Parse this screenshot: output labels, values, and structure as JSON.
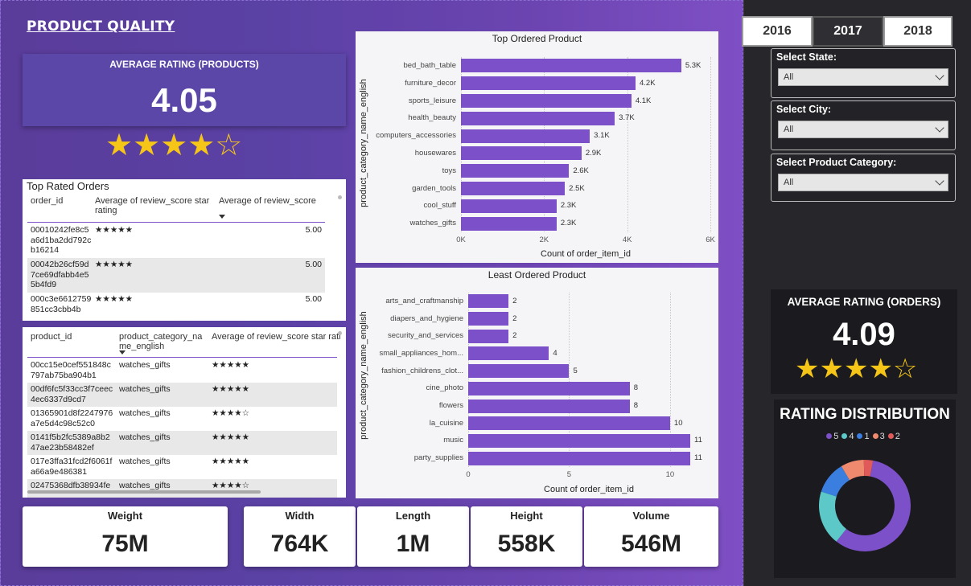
{
  "header": {
    "title": "PRODUCT QUALITY"
  },
  "avg_rating_products": {
    "label": "AVERAGE RATING (PRODUCTS)",
    "value": "4.05",
    "stars": "★★★★☆"
  },
  "top_rated_orders": {
    "title": "Top Rated Orders",
    "headers": [
      "order_id",
      "Average of review_score star rating",
      "Average of review_score"
    ],
    "rows": [
      {
        "order_id": "00010242fe8c5a6d1ba2dd792cb16214",
        "stars": "★★★★★",
        "score": "5.00"
      },
      {
        "order_id": "00042b26cf59d7ce69dfabb4e55b4fd9",
        "stars": "★★★★★",
        "score": "5.00"
      },
      {
        "order_id": "000c3e6612759851cc3cbb4b",
        "stars": "★★★★★",
        "score": "5.00"
      }
    ]
  },
  "product_table": {
    "headers": [
      "product_id",
      "product_category_name_english",
      "Average of review_score star ratir"
    ],
    "rows": [
      {
        "product_id": "00cc15e0cef551848c797ab75ba904b1",
        "category": "watches_gifts",
        "stars": "★★★★★"
      },
      {
        "product_id": "00df6fc5f33cc3f7ceec4ec6337d9cd7",
        "category": "watches_gifts",
        "stars": "★★★★★"
      },
      {
        "product_id": "01365901d8f2247976a7e5d4c98c52c0",
        "category": "watches_gifts",
        "stars": "★★★★☆"
      },
      {
        "product_id": "0141f5b2fc5389a8b247ae23b58482ef",
        "category": "watches_gifts",
        "stars": "★★★★★"
      },
      {
        "product_id": "017e3ffa31fcd2f6061fa66a9e486381",
        "category": "watches_gifts",
        "stars": "★★★★★"
      },
      {
        "product_id": "02475368dfb38934fe",
        "category": "watches_gifts",
        "stars": "★★★★☆"
      }
    ]
  },
  "chart_data": [
    {
      "type": "bar",
      "orientation": "horizontal",
      "title": "Top Ordered Product",
      "xlabel": "Count of order_item_id",
      "ylabel": "product_category_name_english",
      "categories": [
        "bed_bath_table",
        "furniture_decor",
        "sports_leisure",
        "health_beauty",
        "computers_accessories",
        "housewares",
        "toys",
        "garden_tools",
        "cool_stuff",
        "watches_gifts"
      ],
      "values": [
        5300,
        4200,
        4100,
        3700,
        3100,
        2900,
        2600,
        2500,
        2300,
        2300
      ],
      "value_labels": [
        "5.3K",
        "4.2K",
        "4.1K",
        "3.7K",
        "3.1K",
        "2.9K",
        "2.6K",
        "2.5K",
        "2.3K",
        "2.3K"
      ],
      "xlim": [
        0,
        6000
      ],
      "xticks": [
        "0K",
        "2K",
        "4K",
        "6K"
      ],
      "color": "#7c50c8"
    },
    {
      "type": "bar",
      "orientation": "horizontal",
      "title": "Least Ordered Product",
      "xlabel": "Count of order_item_id",
      "ylabel": "product_category_name_english",
      "categories": [
        "arts_and_craftmanship",
        "diapers_and_hygiene",
        "security_and_services",
        "small_appliances_hom...",
        "fashion_childrens_clot...",
        "cine_photo",
        "flowers",
        "la_cuisine",
        "music",
        "party_supplies"
      ],
      "values": [
        2,
        2,
        2,
        4,
        5,
        8,
        8,
        10,
        11,
        11
      ],
      "value_labels": [
        "2",
        "2",
        "2",
        "4",
        "5",
        "8",
        "8",
        "10",
        "11",
        "11"
      ],
      "xlim": [
        0,
        11
      ],
      "xticks": [
        "0",
        "5",
        "10"
      ],
      "color": "#7c50c8"
    },
    {
      "type": "pie",
      "donut": true,
      "title": "RATING DISTRIBUTION",
      "legend": [
        "5",
        "4",
        "1",
        "3",
        "2"
      ],
      "values": [
        57.8,
        19.3,
        11.5,
        8.2,
        3.2
      ],
      "colors": [
        "#7c50c8",
        "#5cc8c8",
        "#3a7ee0",
        "#f08a6e",
        "#e05a5a"
      ],
      "legend_position": "top"
    }
  ],
  "kpis": [
    {
      "label": "Weight",
      "value": "75M"
    },
    {
      "label": "Width",
      "value": "764K"
    },
    {
      "label": "Length",
      "value": "1M"
    },
    {
      "label": "Height",
      "value": "558K"
    },
    {
      "label": "Volume",
      "value": "546M"
    }
  ],
  "years": [
    "2016",
    "2017",
    "2018"
  ],
  "selected_year": "2017",
  "filters": [
    {
      "label": "Select State:",
      "value": "All"
    },
    {
      "label": "Select City:",
      "value": "All"
    },
    {
      "label": "Select Product Category:",
      "value": "All"
    }
  ],
  "avg_rating_orders": {
    "label": "AVERAGE RATING (ORDERS)",
    "value": "4.09",
    "stars": "★★★★☆"
  },
  "colors": {
    "accent": "#7c50c8",
    "star": "#f5c518",
    "background_gradient_start": "#5a3c9a",
    "side_panel": "#26262b"
  }
}
